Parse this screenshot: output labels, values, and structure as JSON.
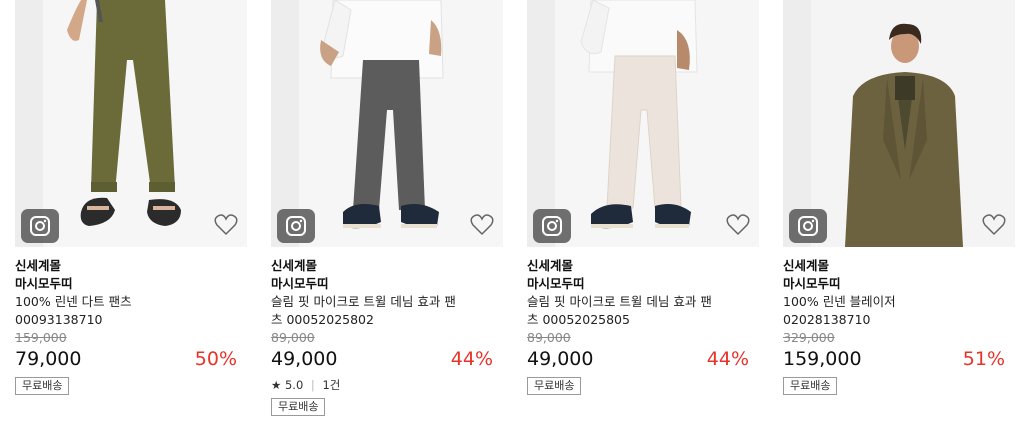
{
  "products": [
    {
      "mall": "신세계몰",
      "brand": "마시모두띠",
      "name": "100% 린넨 다트 팬츠",
      "code": "00093138710",
      "original_price": "159,000",
      "price": "79,000",
      "discount": "50%",
      "shipping": "무료배송",
      "pants_color": "#6b6b3a",
      "instagram_icon": "instagram-icon",
      "wishlist_icon": "heart-icon"
    },
    {
      "mall": "신세계몰",
      "brand": "마시모두띠",
      "name": "슬림 핏 마이크로 트윌 데님 효과 팬",
      "code": "츠 00052025802",
      "original_price": "89,000",
      "price": "49,000",
      "discount": "44%",
      "rating_star": "★",
      "rating_score": "5.0",
      "rating_sep": "|",
      "review_count": "1건",
      "shipping": "무료배송",
      "pants_color": "#5c5c5c",
      "instagram_icon": "instagram-icon",
      "wishlist_icon": "heart-icon"
    },
    {
      "mall": "신세계몰",
      "brand": "마시모두띠",
      "name": "슬림 핏 마이크로 트윌 데님 효과 팬",
      "code": "츠 00052025805",
      "original_price": "89,000",
      "price": "49,000",
      "discount": "44%",
      "shipping": "무료배송",
      "pants_color": "#ece4dc",
      "instagram_icon": "instagram-icon",
      "wishlist_icon": "heart-icon"
    },
    {
      "mall": "신세계몰",
      "brand": "마시모두띠",
      "name": "100% 린넨 블레이저",
      "code": "02028138710",
      "original_price": "329,000",
      "price": "159,000",
      "discount": "51%",
      "shipping": "무료배송",
      "pants_color": "#6d6240",
      "instagram_icon": "instagram-icon",
      "wishlist_icon": "heart-icon"
    }
  ],
  "colors": {
    "discount": "#e6342b",
    "original_price": "#888888",
    "thumb_bg": "#f1f1f1"
  }
}
